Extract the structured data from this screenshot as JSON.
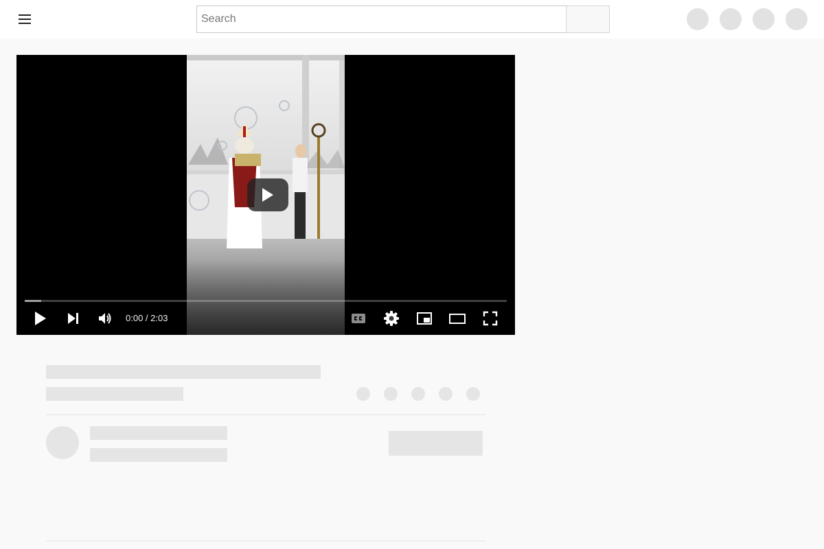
{
  "header": {
    "search": {
      "placeholder": "Search",
      "value": ""
    }
  },
  "player": {
    "current_time": "0:00",
    "separator": " / ",
    "duration": "2:03",
    "loaded_fraction": 0.034,
    "controls": [
      "play-icon",
      "next-icon",
      "volume-icon",
      "captions-icon",
      "settings-icon",
      "miniplayer-icon",
      "theater-mode-icon",
      "fullscreen-icon"
    ]
  },
  "colors": {
    "page_background": "#f9f9f9",
    "header_background": "#ffffff",
    "skeleton": "#e5e5e5",
    "player_background": "#000000"
  }
}
